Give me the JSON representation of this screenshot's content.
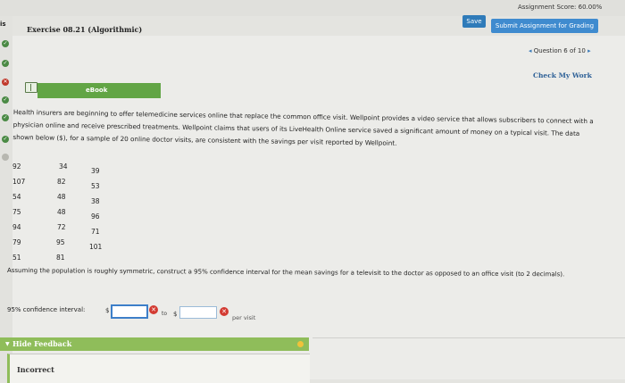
{
  "header": {
    "assignment_score": "Assignment Score: 60.00%",
    "save_label": "Save",
    "submit_label": "Submit Assignment for Grading",
    "left_label": "is",
    "exercise_title": "Exercise 08.21 (Algorithmic)"
  },
  "sidebar": {
    "statuses": [
      "correct",
      "correct",
      "incorrect",
      "correct",
      "correct",
      "correct",
      "partial"
    ]
  },
  "question_nav": {
    "prev_arrow": "◂",
    "label": "Question 6 of 10",
    "next_arrow": "▸"
  },
  "check_work_label": "Check My Work",
  "ebook_label": "eBook",
  "problem": {
    "text": "Health insurers are beginning to offer telemedicine services online that replace the common office visit. Wellpoint provides a video service that allows subscribers to connect with a physician online and receive prescribed treatments. Wellpoint claims that users of its LiveHealth Online service saved a significant amount of money on a typical visit. The data shown below ($), for a sample of 20 online doctor visits, are consistent with the savings per visit reported by Wellpoint."
  },
  "data_columns": [
    [
      "92",
      "107",
      "54",
      "75",
      "94",
      "79",
      "51"
    ],
    [
      "34",
      "82",
      "48",
      "48",
      "72",
      "95",
      "81"
    ],
    [
      "39",
      "53",
      "38",
      "96",
      "71",
      "101"
    ]
  ],
  "question_text": "Assuming the population is roughly symmetric, construct a 95% confidence interval for the mean savings for a televisit to the doctor as opposed to an office visit (to 2 decimals).",
  "answer": {
    "label": "95% confidence interval:",
    "dollar": "$",
    "to_label": "to",
    "lower_value": "",
    "upper_value": "",
    "unit": "per visit"
  },
  "feedback": {
    "hide_label": "Hide Feedback",
    "triangle": "▼",
    "status": "Incorrect"
  },
  "colors": {
    "accent_blue": "#3f8bcf",
    "ebook_green": "#62a545",
    "feedback_green": "#8fbd5a",
    "error_red": "#d33b32"
  }
}
